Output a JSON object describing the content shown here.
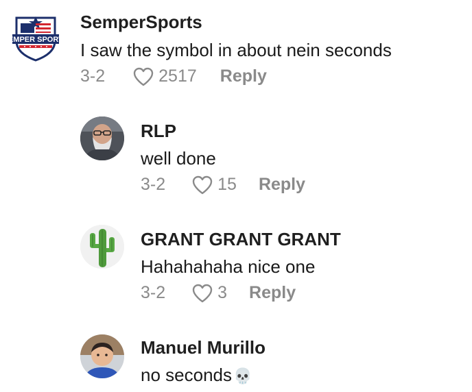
{
  "comments": [
    {
      "username": "SemperSports",
      "text": "I saw the symbol in about nein seconds",
      "date": "3-2",
      "likes": "2517",
      "reply_label": "Reply",
      "avatar": {
        "type": "logo",
        "logo_text": "SEMPER SPORTS",
        "colors": {
          "navy": "#1c2f6b",
          "red": "#d32630"
        }
      }
    },
    {
      "username": "RLP",
      "text": "well done",
      "date": "3-2",
      "likes": "15",
      "reply_label": "Reply",
      "avatar": {
        "type": "photo",
        "subject": "bearded-man-with-glasses"
      }
    },
    {
      "username": "GRANT GRANT GRANT",
      "text": "Hahahahaha nice one",
      "date": "3-2",
      "likes": "3",
      "reply_label": "Reply",
      "avatar": {
        "type": "photo",
        "subject": "cactus"
      }
    },
    {
      "username": "Manuel Murillo",
      "text": "no seconds",
      "emoji": "💀",
      "avatar": {
        "type": "photo",
        "subject": "child"
      }
    }
  ]
}
